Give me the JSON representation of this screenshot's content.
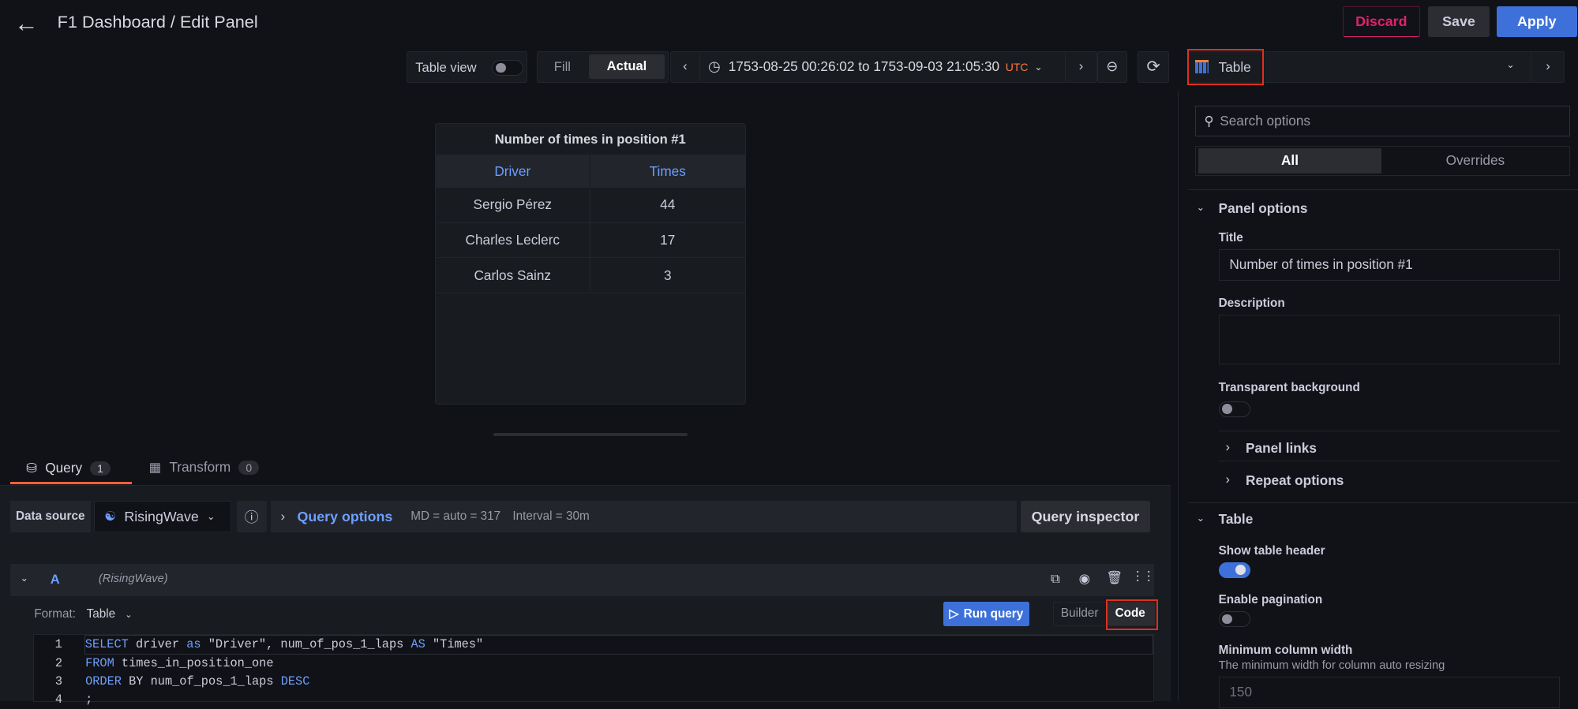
{
  "header": {
    "title": "F1 Dashboard / Edit Panel",
    "discard": "Discard",
    "save": "Save",
    "apply": "Apply"
  },
  "toolbar": {
    "table_view": "Table view",
    "fill": "Fill",
    "actual": "Actual",
    "time_range": "1753-08-25 00:26:02 to 1753-09-03 21:05:30",
    "timezone": "UTC"
  },
  "viz_picker": {
    "label": "Table"
  },
  "panel": {
    "title": "Number of times in position #1",
    "columns": [
      "Driver",
      "Times"
    ],
    "rows": [
      [
        "Sergio Pérez",
        "44"
      ],
      [
        "Charles Leclerc",
        "17"
      ],
      [
        "Carlos Sainz",
        "3"
      ]
    ]
  },
  "tabs": [
    {
      "label": "Query",
      "count": "1"
    },
    {
      "label": "Transform",
      "count": "0"
    }
  ],
  "query": {
    "data_source_label": "Data source",
    "data_source": "RisingWave",
    "query_options": "Query options",
    "md": "MD = auto = 317",
    "interval": "Interval = 30m",
    "inspector": "Query inspector",
    "ref": "A",
    "ref_source": "(RisingWave)",
    "format_label": "Format:",
    "format_value": "Table",
    "run": "Run query",
    "builder": "Builder",
    "code": "Code",
    "lines": [
      {
        "n": "1",
        "kw1": "SELECT",
        "t1": " driver ",
        "kw2": "as",
        "t2": " \"Driver\", num_of_pos_1_laps ",
        "kw3": "AS",
        "t3": " \"Times\""
      },
      {
        "n": "2",
        "kw1": "FROM",
        "t1": " times_in_position_one"
      },
      {
        "n": "3",
        "kw1": "ORDER",
        "t1": " BY num_of_pos_1_laps ",
        "kw2": "DESC"
      },
      {
        "n": "4",
        "t1": ";"
      }
    ]
  },
  "options": {
    "search_placeholder": "Search options",
    "tab_all": "All",
    "tab_overrides": "Overrides",
    "panel_options": "Panel options",
    "title_label": "Title",
    "title_value": "Number of times in position #1",
    "description_label": "Description",
    "transparent_label": "Transparent background",
    "transparent": false,
    "panel_links": "Panel links",
    "repeat_options": "Repeat options",
    "table_section": "Table",
    "show_header_label": "Show table header",
    "show_header": true,
    "pagination_label": "Enable pagination",
    "pagination": false,
    "min_width_label": "Minimum column width",
    "min_width_desc": "The minimum width for column auto resizing",
    "min_width_value": "150"
  },
  "colors": {
    "accent": "#3d71d9",
    "discard": "#e0226e",
    "tab_underline": "#f55f3e",
    "highlight": "#e02f20",
    "utc": "#ff7941"
  }
}
